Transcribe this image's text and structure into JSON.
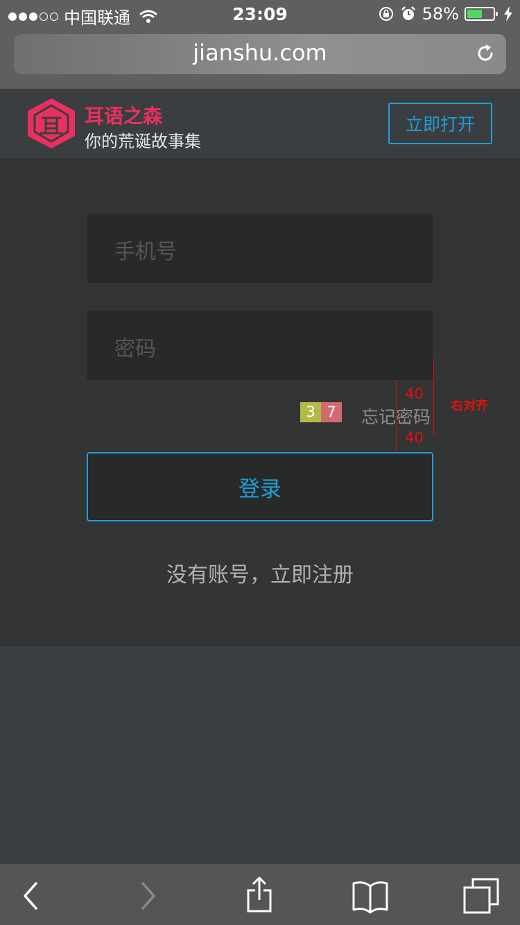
{
  "status_bar": {
    "carrier": "中国联通",
    "time": "23:09",
    "battery": "58%",
    "battery_level": 0.58,
    "icons": [
      "signal-dots",
      "wifi-icon",
      "rotation-lock-icon",
      "alarm-icon",
      "battery-icon",
      "charging-icon"
    ]
  },
  "browser": {
    "url": "jianshu.com",
    "reload_icon": "reload-icon"
  },
  "banner": {
    "app_name": "耳语之森",
    "tagline": "你的荒诞故事集",
    "open_label": "立即打开",
    "logo_icon": "hexagon-logo-icon"
  },
  "login": {
    "phone_placeholder": "手机号",
    "password_placeholder": "密码",
    "forgot_label": "忘记密码",
    "submit_label": "登录",
    "register_label": "没有账号，立即注册"
  },
  "annotations": {
    "badge_a": "3",
    "badge_b": "7",
    "gap_top": "40",
    "gap_bottom": "40",
    "note": "右对齐"
  },
  "toolbar": {
    "icons": [
      "back-icon",
      "forward-icon",
      "share-icon",
      "bookmarks-icon",
      "tabs-icon"
    ]
  },
  "colors": {
    "accent": "#1ea0d8",
    "brand": "#ea3060",
    "panel": "#333434",
    "field": "#282929"
  }
}
